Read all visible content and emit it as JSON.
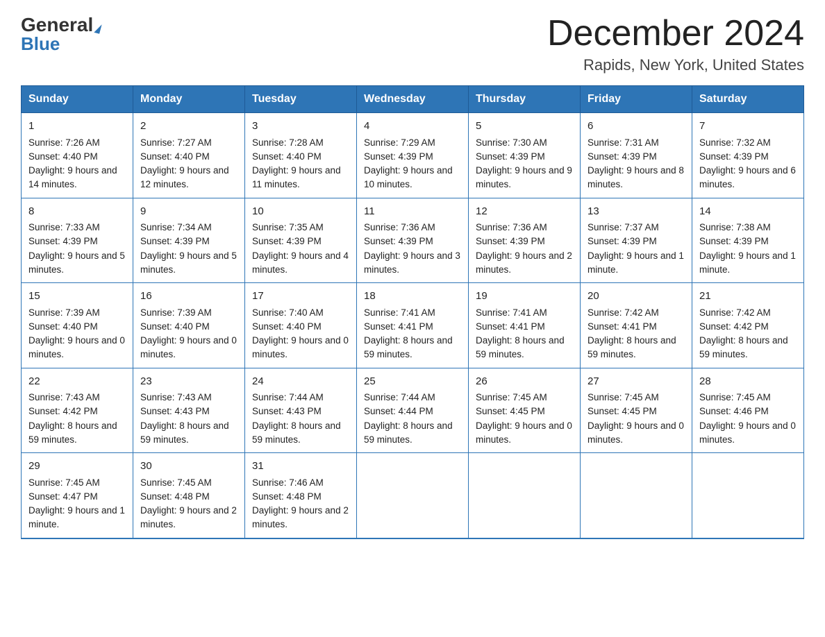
{
  "logo": {
    "general": "General",
    "blue": "Blue",
    "triangle_symbol": "▶"
  },
  "title": {
    "month": "December 2024",
    "location": "Rapids, New York, United States"
  },
  "header_days": [
    "Sunday",
    "Monday",
    "Tuesday",
    "Wednesday",
    "Thursday",
    "Friday",
    "Saturday"
  ],
  "weeks": [
    [
      {
        "day": "1",
        "sunrise": "7:26 AM",
        "sunset": "4:40 PM",
        "daylight": "9 hours and 14 minutes."
      },
      {
        "day": "2",
        "sunrise": "7:27 AM",
        "sunset": "4:40 PM",
        "daylight": "9 hours and 12 minutes."
      },
      {
        "day": "3",
        "sunrise": "7:28 AM",
        "sunset": "4:40 PM",
        "daylight": "9 hours and 11 minutes."
      },
      {
        "day": "4",
        "sunrise": "7:29 AM",
        "sunset": "4:39 PM",
        "daylight": "9 hours and 10 minutes."
      },
      {
        "day": "5",
        "sunrise": "7:30 AM",
        "sunset": "4:39 PM",
        "daylight": "9 hours and 9 minutes."
      },
      {
        "day": "6",
        "sunrise": "7:31 AM",
        "sunset": "4:39 PM",
        "daylight": "9 hours and 8 minutes."
      },
      {
        "day": "7",
        "sunrise": "7:32 AM",
        "sunset": "4:39 PM",
        "daylight": "9 hours and 6 minutes."
      }
    ],
    [
      {
        "day": "8",
        "sunrise": "7:33 AM",
        "sunset": "4:39 PM",
        "daylight": "9 hours and 5 minutes."
      },
      {
        "day": "9",
        "sunrise": "7:34 AM",
        "sunset": "4:39 PM",
        "daylight": "9 hours and 5 minutes."
      },
      {
        "day": "10",
        "sunrise": "7:35 AM",
        "sunset": "4:39 PM",
        "daylight": "9 hours and 4 minutes."
      },
      {
        "day": "11",
        "sunrise": "7:36 AM",
        "sunset": "4:39 PM",
        "daylight": "9 hours and 3 minutes."
      },
      {
        "day": "12",
        "sunrise": "7:36 AM",
        "sunset": "4:39 PM",
        "daylight": "9 hours and 2 minutes."
      },
      {
        "day": "13",
        "sunrise": "7:37 AM",
        "sunset": "4:39 PM",
        "daylight": "9 hours and 1 minute."
      },
      {
        "day": "14",
        "sunrise": "7:38 AM",
        "sunset": "4:39 PM",
        "daylight": "9 hours and 1 minute."
      }
    ],
    [
      {
        "day": "15",
        "sunrise": "7:39 AM",
        "sunset": "4:40 PM",
        "daylight": "9 hours and 0 minutes."
      },
      {
        "day": "16",
        "sunrise": "7:39 AM",
        "sunset": "4:40 PM",
        "daylight": "9 hours and 0 minutes."
      },
      {
        "day": "17",
        "sunrise": "7:40 AM",
        "sunset": "4:40 PM",
        "daylight": "9 hours and 0 minutes."
      },
      {
        "day": "18",
        "sunrise": "7:41 AM",
        "sunset": "4:41 PM",
        "daylight": "8 hours and 59 minutes."
      },
      {
        "day": "19",
        "sunrise": "7:41 AM",
        "sunset": "4:41 PM",
        "daylight": "8 hours and 59 minutes."
      },
      {
        "day": "20",
        "sunrise": "7:42 AM",
        "sunset": "4:41 PM",
        "daylight": "8 hours and 59 minutes."
      },
      {
        "day": "21",
        "sunrise": "7:42 AM",
        "sunset": "4:42 PM",
        "daylight": "8 hours and 59 minutes."
      }
    ],
    [
      {
        "day": "22",
        "sunrise": "7:43 AM",
        "sunset": "4:42 PM",
        "daylight": "8 hours and 59 minutes."
      },
      {
        "day": "23",
        "sunrise": "7:43 AM",
        "sunset": "4:43 PM",
        "daylight": "8 hours and 59 minutes."
      },
      {
        "day": "24",
        "sunrise": "7:44 AM",
        "sunset": "4:43 PM",
        "daylight": "8 hours and 59 minutes."
      },
      {
        "day": "25",
        "sunrise": "7:44 AM",
        "sunset": "4:44 PM",
        "daylight": "8 hours and 59 minutes."
      },
      {
        "day": "26",
        "sunrise": "7:45 AM",
        "sunset": "4:45 PM",
        "daylight": "9 hours and 0 minutes."
      },
      {
        "day": "27",
        "sunrise": "7:45 AM",
        "sunset": "4:45 PM",
        "daylight": "9 hours and 0 minutes."
      },
      {
        "day": "28",
        "sunrise": "7:45 AM",
        "sunset": "4:46 PM",
        "daylight": "9 hours and 0 minutes."
      }
    ],
    [
      {
        "day": "29",
        "sunrise": "7:45 AM",
        "sunset": "4:47 PM",
        "daylight": "9 hours and 1 minute."
      },
      {
        "day": "30",
        "sunrise": "7:45 AM",
        "sunset": "4:48 PM",
        "daylight": "9 hours and 2 minutes."
      },
      {
        "day": "31",
        "sunrise": "7:46 AM",
        "sunset": "4:48 PM",
        "daylight": "9 hours and 2 minutes."
      },
      null,
      null,
      null,
      null
    ]
  ],
  "labels": {
    "sunrise": "Sunrise:",
    "sunset": "Sunset:",
    "daylight": "Daylight:"
  }
}
